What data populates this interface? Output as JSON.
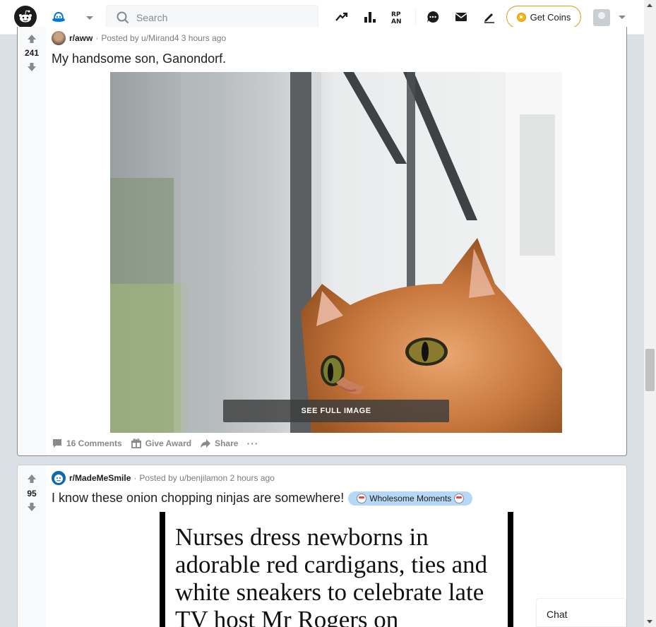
{
  "header": {
    "search_placeholder": "Search",
    "get_coins_label": "Get Coins",
    "icons": [
      "reddit-logo-icon",
      "home-icon",
      "trending-icon",
      "leaderboard-icon",
      "rpan-icon",
      "chat-icon",
      "mail-icon",
      "create-post-icon"
    ]
  },
  "posts": [
    {
      "subreddit": "r/aww",
      "posted_by": "Posted by u/Mirand4 3 hours ago",
      "score": "241",
      "title": "My handsome son, Ganondorf.",
      "image_button": "SEE FULL IMAGE",
      "comments_label": "16 Comments",
      "award_label": "Give Award",
      "share_label": "Share",
      "more_label": "···"
    },
    {
      "subreddit": "r/MadeMeSmile",
      "posted_by": "Posted by u/benjilamon 2 hours ago",
      "score": "95",
      "title": "I know these onion chopping ninjas are somewhere!",
      "flair": "Wholesome Moments",
      "article_headline": "Nurses dress newborns in adorable red cardigans, ties and white sneakers to celebrate late TV host Mr Rogers on"
    }
  ],
  "chat": {
    "label": "Chat"
  },
  "colors": {
    "accent": "#0079d3",
    "coin_border": "#d4a017",
    "flair_bg": "#b7d7f6"
  }
}
